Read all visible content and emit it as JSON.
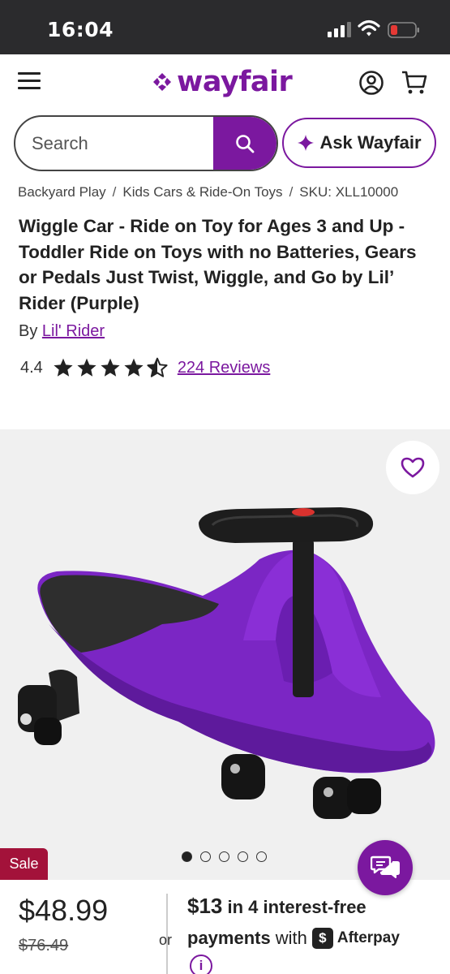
{
  "status_bar": {
    "time": "16:04"
  },
  "header": {
    "logo_text": "wayfair",
    "brand_color": "#7b189f"
  },
  "search": {
    "placeholder": "Search",
    "value": ""
  },
  "ask": {
    "label": "Ask Wayfair"
  },
  "breadcrumb": {
    "items": [
      "Backyard Play",
      "Kids Cars & Ride-On Toys",
      "SKU: XLL10000"
    ],
    "separator": "/"
  },
  "product": {
    "title": "Wiggle Car - Ride on Toy for Ages 3 and Up - Toddler Ride on Toys with no Batteries, Gears or Pedals Just Twist, Wiggle, and Go by Lil’ Rider (Purple)",
    "by_label": "By",
    "brand": "Lil' Rider",
    "rating": 4.4,
    "rating_text": "4.4",
    "reviews_label": "224 Reviews",
    "image_count": 5,
    "active_image": 1,
    "sale_badge": "Sale",
    "price": "$48.99",
    "old_price": "$76.49"
  },
  "afterpay": {
    "or": "or",
    "amount": "$13",
    "line1_rest": " in 4 interest-free",
    "line2_bold": "payments",
    "line2_with": "with",
    "brand": "Afterpay",
    "mark": "$"
  }
}
